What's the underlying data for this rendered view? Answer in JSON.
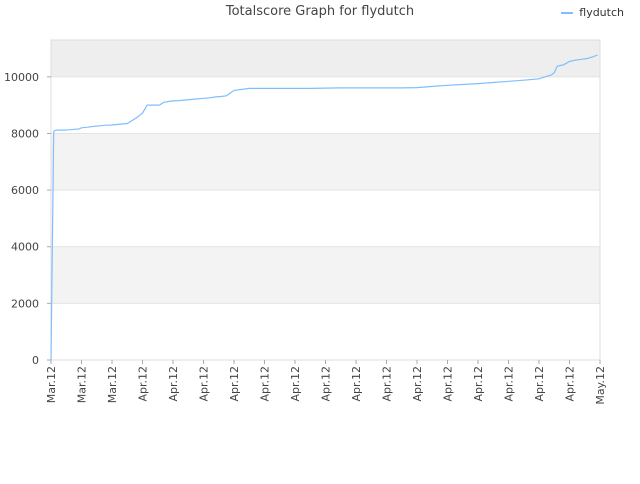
{
  "chart_data": {
    "type": "line",
    "title": "Totalscore Graph for flydutch",
    "xlabel": "",
    "ylabel": "",
    "ylim": [
      0,
      11300
    ],
    "yticks": [
      0,
      2000,
      4000,
      6000,
      8000,
      10000
    ],
    "x_tick_labels": [
      "Mar.12",
      "Mar.12",
      "Mar.12",
      "Apr.12",
      "Apr.12",
      "Apr.12",
      "Apr.12",
      "Apr.12",
      "Apr.12",
      "Apr.12",
      "Apr.12",
      "Apr.12",
      "Apr.12",
      "Apr.12",
      "Apr.12",
      "Apr.12",
      "Apr.12",
      "Apr.12",
      "May.12"
    ],
    "grid": true,
    "legend": "top-right",
    "colors": {
      "series": "#7fbfff",
      "band_dark": "#eeeeee",
      "band_light": "#f3f3f3",
      "axis": "#cccccc",
      "text": "#444444"
    },
    "series": [
      {
        "name": "flydutch",
        "x": [
          0.0,
          0.09,
          0.12,
          0.18,
          0.3,
          0.45,
          0.6,
          0.8,
          0.9,
          1.0,
          1.2,
          1.4,
          1.6,
          1.8,
          2.0,
          2.2,
          2.5,
          2.8,
          3.0,
          3.15,
          3.3,
          3.55,
          3.7,
          3.85,
          4.0,
          4.2,
          4.4,
          4.6,
          4.8,
          5.0,
          5.2,
          5.4,
          5.6,
          5.75,
          6.0,
          6.5,
          7.0,
          7.5,
          8.0,
          8.5,
          9.0,
          9.5,
          10.0,
          10.5,
          11.0,
          11.5,
          12.0,
          12.5,
          13.0,
          13.5,
          14.0,
          14.5,
          15.0,
          15.5,
          16.0,
          16.2,
          16.4,
          16.5,
          16.6,
          16.8,
          17.0,
          17.2,
          17.4,
          17.6,
          17.8,
          17.92
        ],
        "y": [
          0,
          8050,
          8100,
          8120,
          8120,
          8120,
          8130,
          8150,
          8150,
          8200,
          8220,
          8250,
          8270,
          8290,
          8300,
          8320,
          8350,
          8550,
          8720,
          9000,
          9000,
          9000,
          9100,
          9130,
          9150,
          9160,
          9180,
          9200,
          9220,
          9240,
          9260,
          9290,
          9310,
          9330,
          9520,
          9590,
          9590,
          9590,
          9590,
          9590,
          9600,
          9610,
          9610,
          9610,
          9610,
          9610,
          9620,
          9660,
          9700,
          9730,
          9760,
          9800,
          9840,
          9880,
          9930,
          10000,
          10060,
          10150,
          10380,
          10420,
          10540,
          10590,
          10620,
          10650,
          10720,
          10770
        ]
      }
    ]
  }
}
